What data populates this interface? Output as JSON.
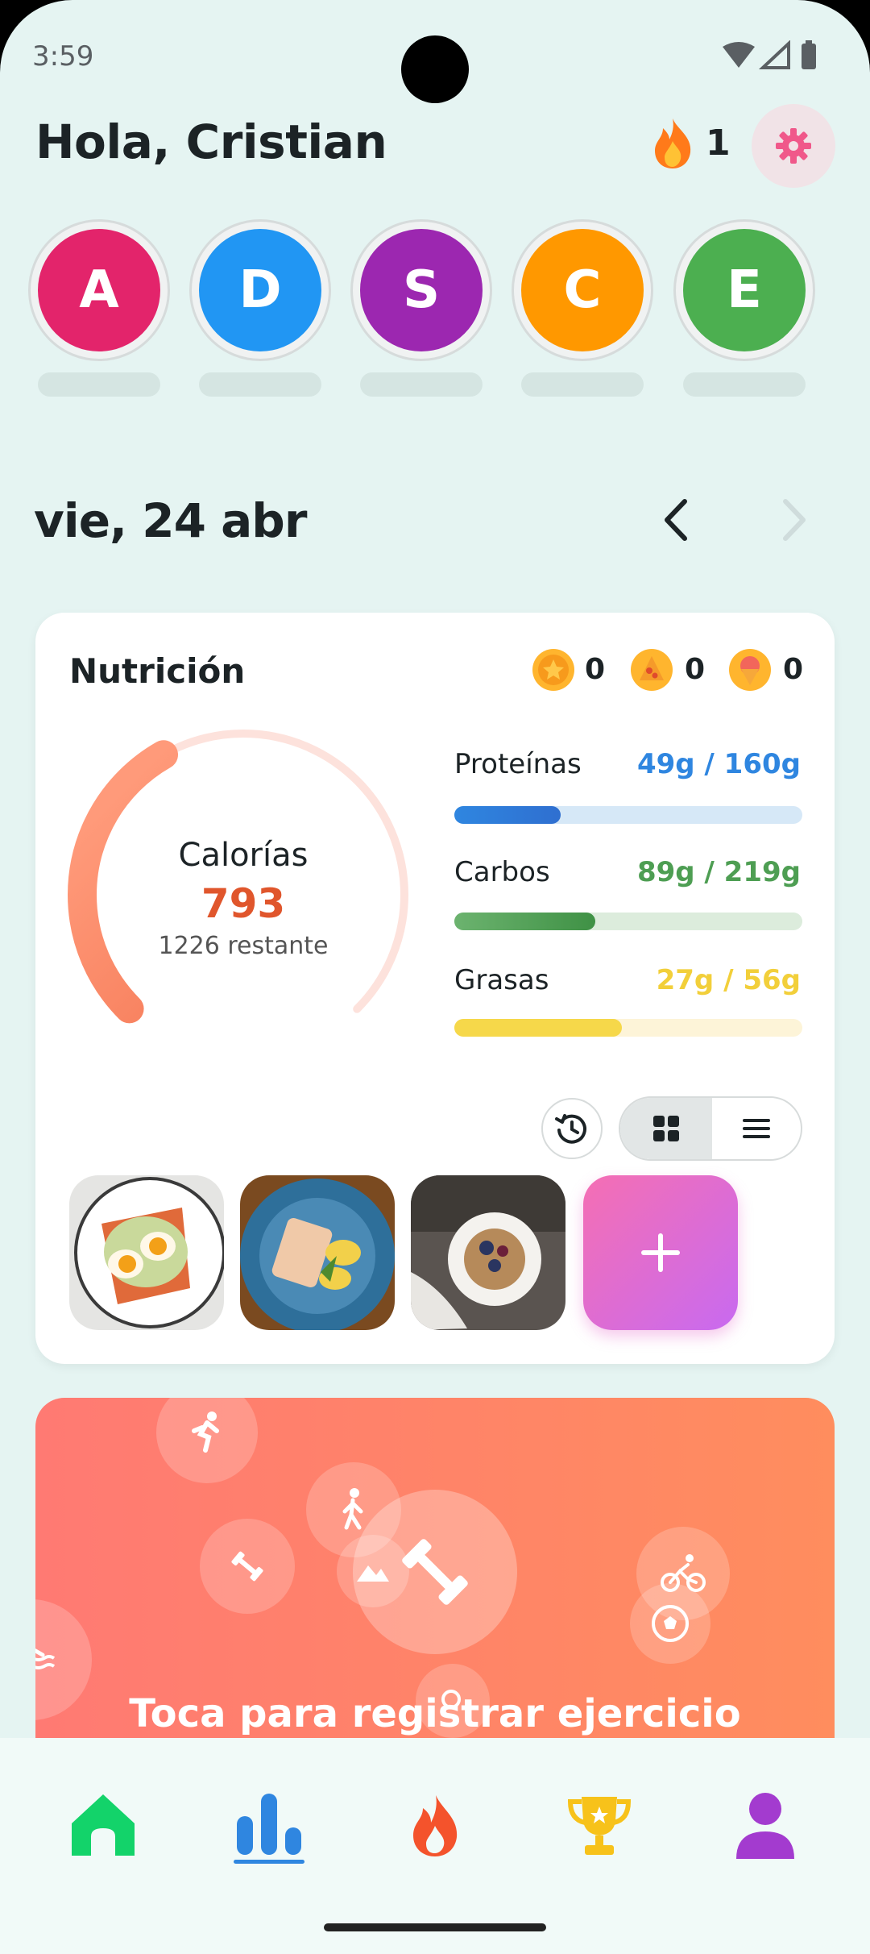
{
  "status_bar": {
    "time": "3:59"
  },
  "header": {
    "greeting": "Hola, Cristian",
    "streak_count": "1"
  },
  "avatars": [
    {
      "letter": "A",
      "color": "#e3246b"
    },
    {
      "letter": "D",
      "color": "#2196f3"
    },
    {
      "letter": "S",
      "color": "#9c27b0"
    },
    {
      "letter": "C",
      "color": "#ff9800"
    },
    {
      "letter": "E",
      "color": "#4caf50"
    }
  ],
  "date_nav": {
    "date": "vie, 24 abr"
  },
  "nutrition": {
    "title": "Nutrición",
    "badges": [
      {
        "icon": "star-coin-icon",
        "count": "0"
      },
      {
        "icon": "pizza-icon",
        "count": "0"
      },
      {
        "icon": "ice-cream-icon",
        "count": "0"
      }
    ],
    "calories": {
      "label": "Calorías",
      "value": "793",
      "remaining": "1226 restante",
      "progress": 0.39
    },
    "macros": [
      {
        "name": "Proteínas",
        "value": "49g / 160g",
        "progress": 0.306,
        "color": "#2f86e0",
        "track": "#d6e8f7"
      },
      {
        "name": "Carbos",
        "value": "89g / 219g",
        "progress": 0.406,
        "color": "#4e9e53",
        "track": "#dcecdc"
      },
      {
        "name": "Grasas",
        "value": "27g / 56g",
        "progress": 0.482,
        "color": "#f6d84a",
        "track": "#fdf4d8"
      }
    ],
    "meal_photos": [
      "egg-avocado-toast",
      "salmon-potatoes-plate",
      "yogurt-berries-bowl"
    ]
  },
  "exercise": {
    "cta": "Toca para registrar ejercicio"
  },
  "bottom_nav": [
    {
      "name": "home",
      "icon": "home-icon"
    },
    {
      "name": "stats",
      "icon": "bar-chart-icon"
    },
    {
      "name": "streak",
      "icon": "flame-icon"
    },
    {
      "name": "achievements",
      "icon": "trophy-icon"
    },
    {
      "name": "profile",
      "icon": "person-icon"
    }
  ]
}
